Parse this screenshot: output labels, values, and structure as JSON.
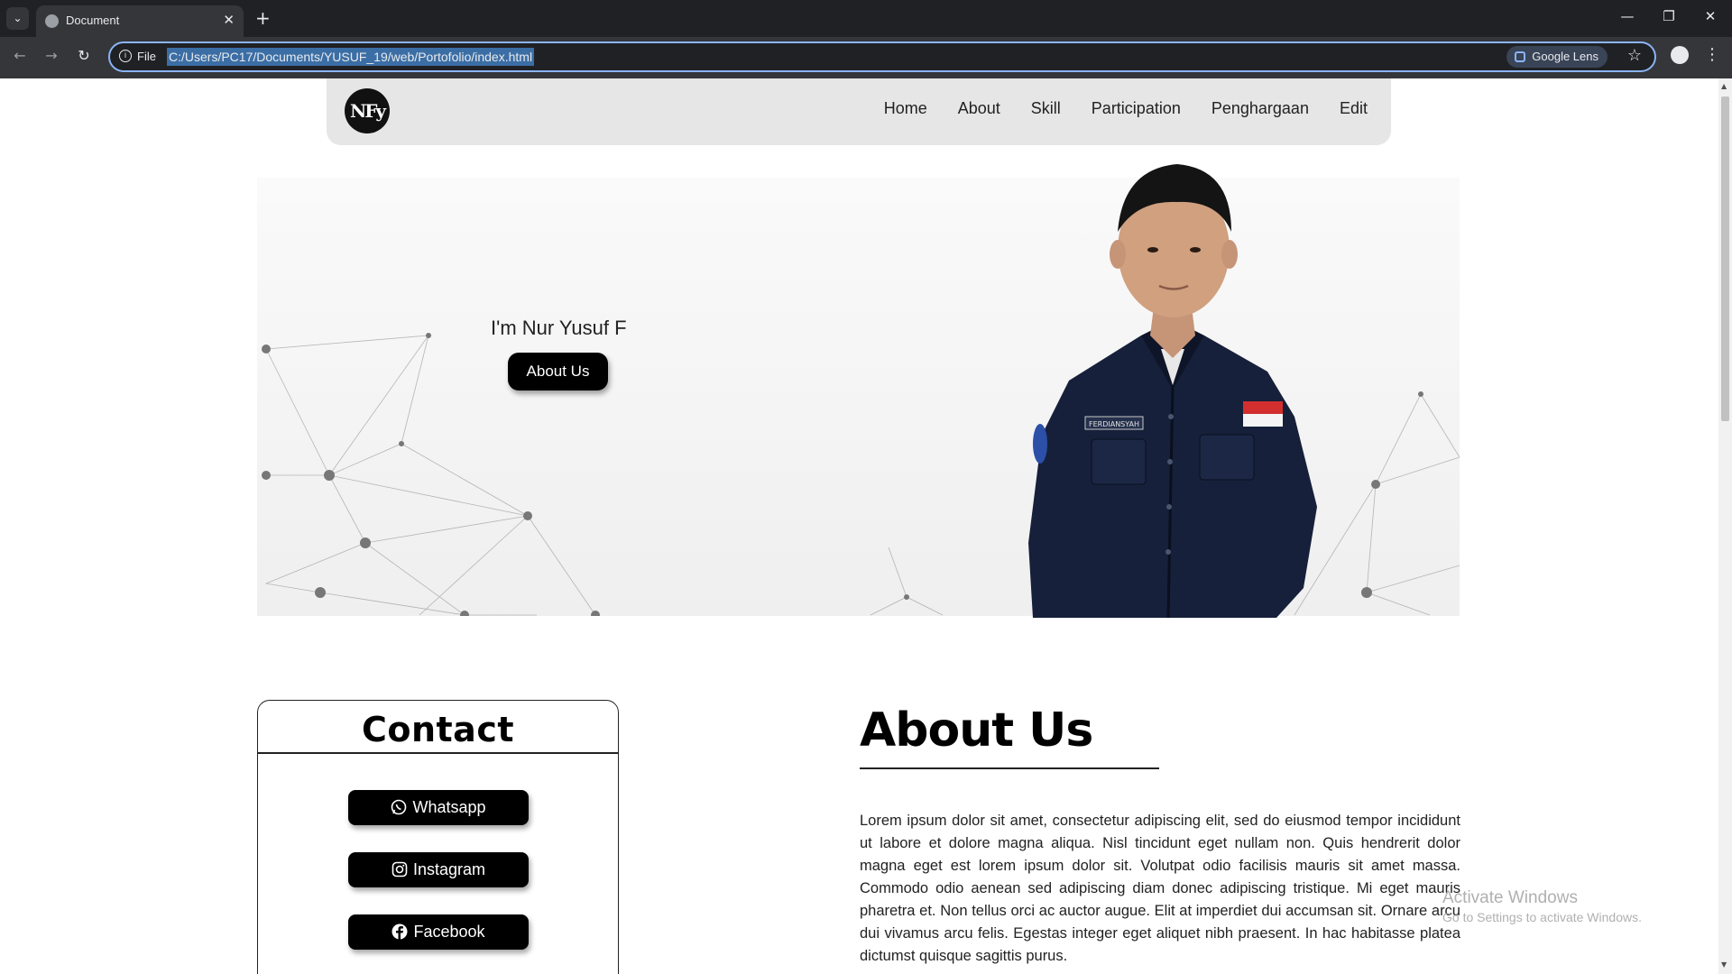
{
  "browser": {
    "tab": {
      "title": "Document"
    },
    "omnibox": {
      "scheme_label": "File",
      "url": "C:/Users/PC17/Documents/YUSUF_19/web/Portofolio/index.html"
    },
    "google_lens_label": "Google Lens"
  },
  "navbar": {
    "logo_text": "NFy",
    "links": [
      "Home",
      "About",
      "Skill",
      "Participation",
      "Penghargaan",
      "Edit"
    ]
  },
  "hero": {
    "name_text": "I'm Nur Yusuf F",
    "button_label": "About Us",
    "badge_text": "FERDIANSYAH"
  },
  "contact": {
    "title": "Contact",
    "buttons": [
      "Whatsapp",
      "Instagram",
      "Facebook"
    ]
  },
  "about": {
    "heading": "About Us",
    "paragraph": "Lorem ipsum dolor sit amet, consectetur adipiscing elit, sed do eiusmod tempor incididunt ut labore et dolore magna aliqua. Nisl tincidunt eget nullam non. Quis hendrerit dolor magna eget est lorem ipsum dolor sit. Volutpat odio facilisis mauris sit amet massa. Commodo odio aenean sed adipiscing diam donec adipiscing tristique. Mi eget mauris pharetra et. Non tellus orci ac auctor augue. Elit at imperdiet dui accumsan sit. Ornare arcu dui vivamus arcu felis. Egestas integer eget aliquet nibh praesent. In hac habitasse platea dictumst quisque sagittis purus."
  },
  "watermark": {
    "title": "Activate Windows",
    "subtitle": "Go to Settings to activate Windows."
  }
}
